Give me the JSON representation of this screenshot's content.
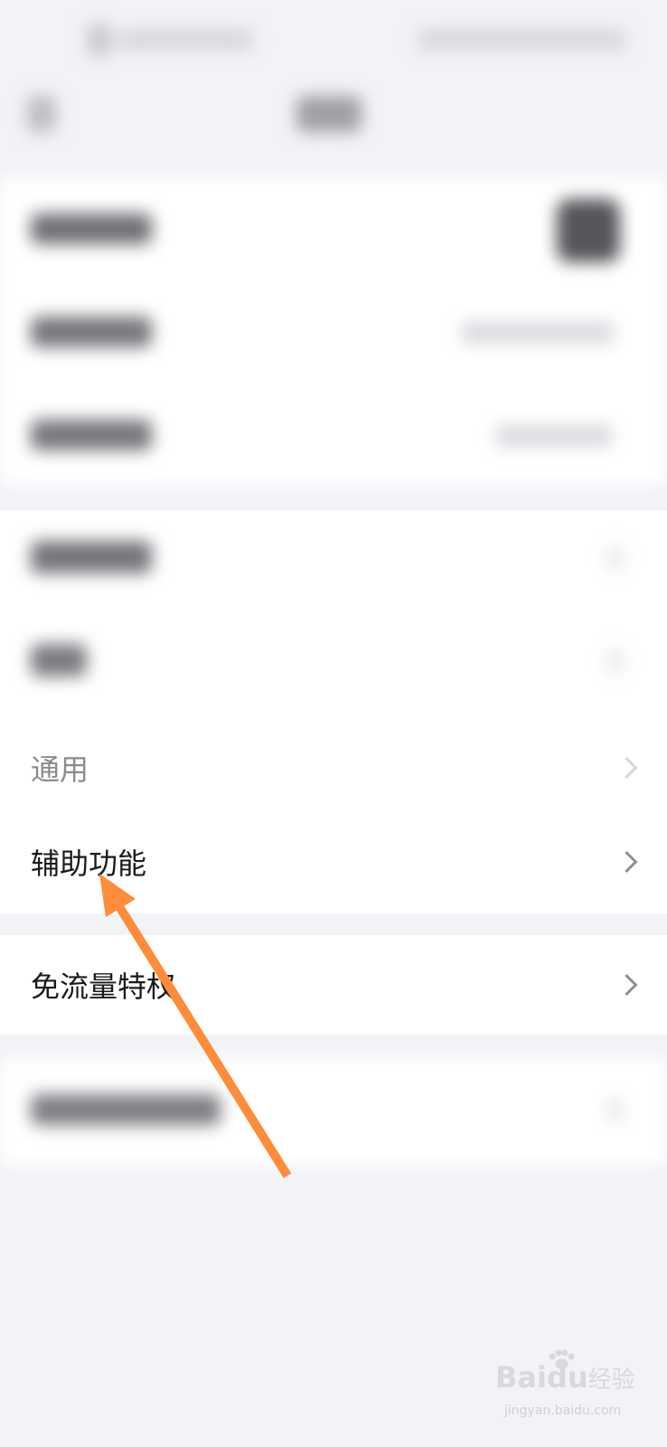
{
  "settings": {
    "rows": [
      {
        "label": "通用"
      },
      {
        "label": "辅助功能"
      },
      {
        "label": "免流量特权"
      }
    ]
  },
  "watermark": {
    "brand_left": "Bai",
    "brand_right": "du",
    "brand_cn": "经验",
    "domain": "jingyan.baidu.com"
  },
  "colors": {
    "background": "#f2f3f7",
    "row_background": "#ffffff",
    "arrow": "#ff8c3a"
  }
}
